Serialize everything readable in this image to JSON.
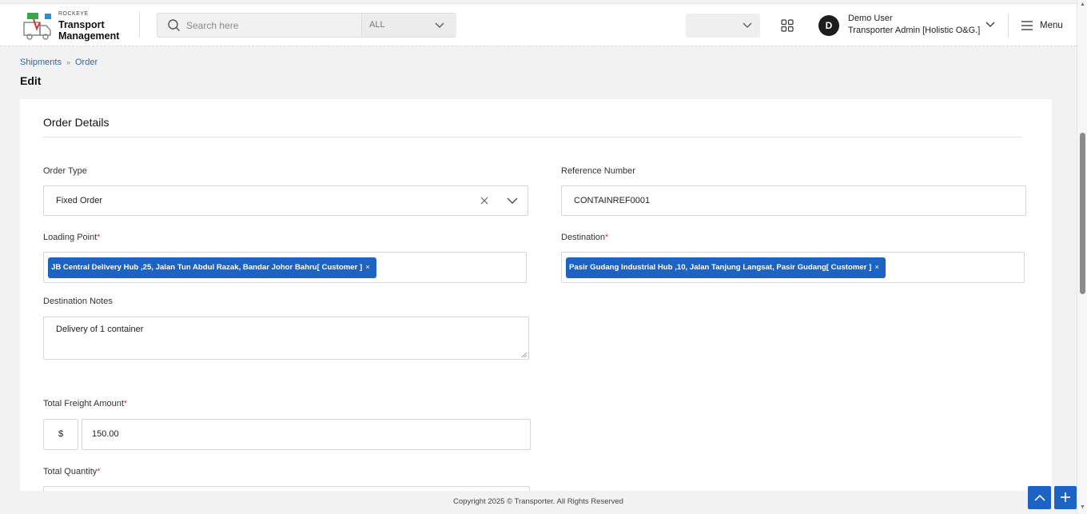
{
  "header": {
    "logo_brand": "ROCKEYE",
    "logo_line1": "Transport",
    "logo_line2": "Management",
    "search_placeholder": "Search here",
    "search_scope": "ALL",
    "user_initial": "D",
    "user_name": "Demo User",
    "user_role": "Transporter Admin [Holistic O&G.]",
    "menu_label": "Menu"
  },
  "breadcrumb": {
    "items": [
      "Shipments",
      "Order"
    ]
  },
  "page_title": "Edit",
  "form": {
    "section_title": "Order Details",
    "order_type": {
      "label": "Order Type",
      "value": "Fixed Order"
    },
    "reference_number": {
      "label": "Reference Number",
      "value": "CONTAINREF0001"
    },
    "loading_point": {
      "label": "Loading Point",
      "required_mark": "*",
      "chip": "JB Central Delivery Hub ,25, Jalan Tun Abdul Razak, Bandar Johor Bahru[ Customer ]",
      "chip_remove": "×"
    },
    "destination": {
      "label": "Destination",
      "required_mark": "*",
      "chip": "Pasir Gudang Industrial Hub ,10, Jalan Tanjung Langsat, Pasir Gudang[ Customer ]",
      "chip_remove": "×"
    },
    "destination_notes": {
      "label": "Destination Notes",
      "value": "Delivery of 1 container"
    },
    "total_freight_amount": {
      "label": "Total Freight Amount",
      "required_mark": "*",
      "currency": "$",
      "value": "150.00"
    },
    "total_quantity": {
      "label": "Total Quantity",
      "required_mark": "*"
    }
  },
  "footer": {
    "copyright": "Copyright 2025 © Transporter. All Rights Reserved"
  },
  "colors": {
    "accent": "#1c63c4",
    "link": "#2a66b0",
    "required": "#d9342b"
  }
}
